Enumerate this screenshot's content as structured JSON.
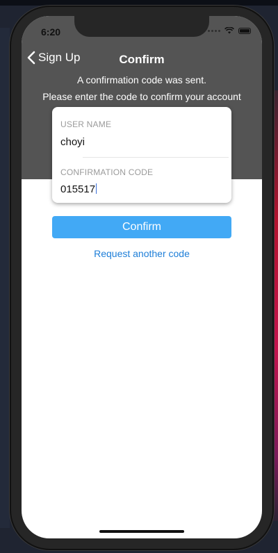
{
  "status_bar": {
    "time": "6:20"
  },
  "nav": {
    "back_label": "Sign Up",
    "title": "Confirm"
  },
  "info": {
    "line1": "A confirmation code was sent.",
    "line2": "Please enter the code to confirm your account"
  },
  "form": {
    "username_label": "USER NAME",
    "username_value": "choyi",
    "code_label": "CONFIRMATION CODE",
    "code_value": "015517"
  },
  "actions": {
    "confirm_label": "Confirm",
    "request_code_label": "Request another code"
  },
  "colors": {
    "header_bg": "#545454",
    "accent": "#42a9f5",
    "link": "#1d7ed8"
  },
  "icons": {
    "back": "chevron-left-icon",
    "wifi": "wifi-icon",
    "battery": "battery-icon",
    "signal": "signal-icon"
  }
}
